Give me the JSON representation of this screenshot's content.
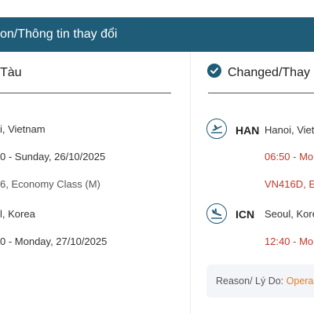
{
  "header": {
    "title": "on/Thông tin thay đổi"
  },
  "original": {
    "title": "Tàu",
    "departure_city": "i, Vietnam",
    "departure_datetime": "0 - Sunday, 26/10/2025",
    "flight_info": "6, Economy Class (M)",
    "arrival_city": "l, Korea",
    "arrival_datetime": "0 - Monday, 27/10/2025"
  },
  "changed": {
    "title": "Changed/Thay",
    "departure_code": "HAN",
    "departure_city": "Hanoi, Viet",
    "departure_time": "06:50 - Mon",
    "flight_info": "VN416D, E",
    "arrival_code": "ICN",
    "arrival_city": "Seoul, Kore",
    "arrival_time": "12:40 - Mor",
    "reason_label": "Reason/ Lý Do: ",
    "reason_value": "Opera"
  },
  "icons": {
    "check": "check-circle-icon",
    "takeoff": "plane-takeoff-icon",
    "landing": "plane-landing-icon"
  },
  "colors": {
    "header_bg": "#1e5c78",
    "time_red": "#c0392b",
    "reason_orange": "#e67e22"
  }
}
